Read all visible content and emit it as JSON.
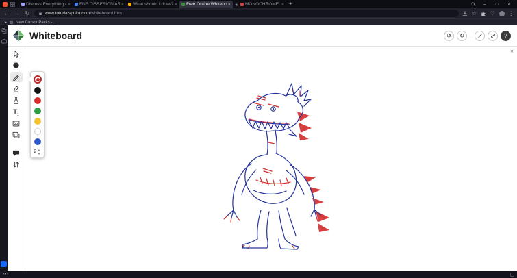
{
  "browser": {
    "logo_color": "#ff4b2e",
    "tabs": [
      {
        "title": "Discuss Everything About t...",
        "favicon_color": "#9aa0ff",
        "active": false
      },
      {
        "title": "FNF DISSESION ART - Go...",
        "favicon_color": "#4285f4",
        "active": false
      },
      {
        "title": "What should I draw? | Fan...",
        "favicon_color": "#f4b400",
        "active": false
      },
      {
        "title": "Free Online Whiteboard",
        "favicon_color": "#3a8d3f",
        "active": true
      },
      {
        "title": "MONOCHROME (Chur...",
        "favicon_color": "#d2413c",
        "active": false,
        "audio": true
      }
    ],
    "new_tab_glyph": "+",
    "tab_close_glyph": "✕",
    "window_controls": {
      "minimize": "–",
      "maximize": "□",
      "close": "✕"
    },
    "nav": {
      "back": "←",
      "forward": "→",
      "reload": "↻"
    },
    "address": {
      "url_host": "www.tutorialspoint.com",
      "url_path": "/whiteboard.htm"
    },
    "icon_glyphs": {
      "star": "☆",
      "heart": "♡",
      "menu": "⋮"
    },
    "bookmarks": {
      "chevron": "▸",
      "items": [
        {
          "label": "New Cursor Packs -..."
        }
      ]
    }
  },
  "sidebar": {
    "pinned_app_color": "#1769ff"
  },
  "statusbar": {
    "more_dots": "•••"
  },
  "whiteboard": {
    "title": "Whiteboard",
    "actions": {
      "undo_glyph": "↺",
      "redo_glyph": "↻",
      "help_glyph": "?"
    },
    "collapse_glyph": "«",
    "tools": {
      "selected": "pencil",
      "names": [
        "pointer",
        "dot",
        "pencil",
        "marker",
        "flask",
        "text",
        "image",
        "gallery",
        "chat",
        "swap"
      ]
    },
    "text_tool_label": "T",
    "text_tool_sub": "1",
    "palette": {
      "current_color": "#d42a2a",
      "swatches": [
        "#111111",
        "#d82b2b",
        "#2f9e44",
        "#f2c230",
        "#ffffff",
        "#2f58c9"
      ],
      "stroke_width": "2"
    },
    "canvas": {
      "description": "hand-drawn monster sketch in blue ink with red accents",
      "ink_primary": "#24339b",
      "ink_accent": "#d43030"
    }
  }
}
